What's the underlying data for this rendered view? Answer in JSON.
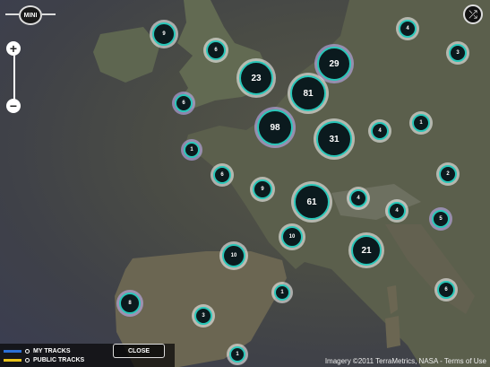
{
  "app": {
    "logo_text": "MINI"
  },
  "zoom": {
    "in_label": "+",
    "out_label": "−"
  },
  "controls": {
    "shuffle_icon": "shuffle-icon",
    "close_label": "CLOSE"
  },
  "legend": {
    "my_tracks": {
      "label": "MY TRACKS",
      "color": "#2b6fd6"
    },
    "public_tracks": {
      "label": "PUBLIC TRACKS",
      "color": "#e8c21a"
    }
  },
  "attribution": "Imagery ©2011 TerraMetrics, NASA - Terms of Use",
  "colors": {
    "marker_ring": "#28c7b9",
    "marker_fill": "#0b1a1e"
  },
  "markers": [
    {
      "label": "9"
    },
    {
      "label": "6"
    },
    {
      "label": "23"
    },
    {
      "label": "29"
    },
    {
      "label": "4"
    },
    {
      "label": "3"
    },
    {
      "label": "81"
    },
    {
      "label": "6"
    },
    {
      "label": "98"
    },
    {
      "label": "1"
    },
    {
      "label": "31"
    },
    {
      "label": "4"
    },
    {
      "label": "1"
    },
    {
      "label": "6"
    },
    {
      "label": "2"
    },
    {
      "label": "9"
    },
    {
      "label": "61"
    },
    {
      "label": "4"
    },
    {
      "label": "4"
    },
    {
      "label": "5"
    },
    {
      "label": "10"
    },
    {
      "label": "21"
    },
    {
      "label": "10"
    },
    {
      "label": "6"
    },
    {
      "label": "8"
    },
    {
      "label": "1"
    },
    {
      "label": "3"
    },
    {
      "label": "1"
    }
  ]
}
